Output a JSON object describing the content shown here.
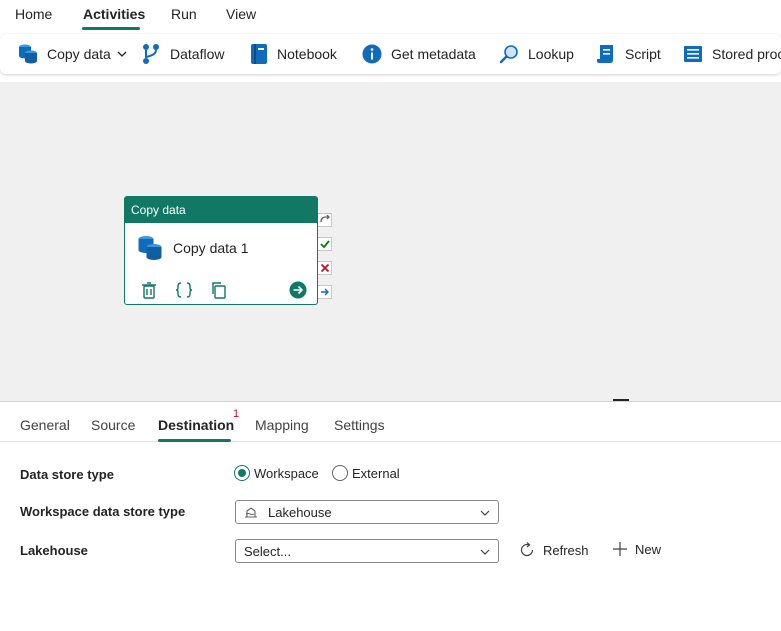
{
  "menu": {
    "items": [
      {
        "label": "Home",
        "active": false
      },
      {
        "label": "Activities",
        "active": true
      },
      {
        "label": "Run",
        "active": false
      },
      {
        "label": "View",
        "active": false
      }
    ]
  },
  "toolbar": {
    "items": [
      {
        "label": "Copy data",
        "icon": "copy-data-icon",
        "has_dropdown": true
      },
      {
        "label": "Dataflow",
        "icon": "dataflow-icon"
      },
      {
        "label": "Notebook",
        "icon": "notebook-icon"
      },
      {
        "label": "Get metadata",
        "icon": "info-icon"
      },
      {
        "label": "Lookup",
        "icon": "search-icon"
      },
      {
        "label": "Script",
        "icon": "script-icon"
      },
      {
        "label": "Stored procedure",
        "icon": "stored-procedure-icon"
      }
    ]
  },
  "activity": {
    "header": "Copy data",
    "name": "Copy data 1",
    "actions": [
      "delete-icon",
      "code-icon",
      "copy-icon",
      "arrow-right-icon"
    ]
  },
  "tabs": {
    "items": [
      {
        "label": "General",
        "active": false
      },
      {
        "label": "Source",
        "active": false
      },
      {
        "label": "Destination",
        "active": true,
        "badge": "1"
      },
      {
        "label": "Mapping",
        "active": false
      },
      {
        "label": "Settings",
        "active": false
      }
    ]
  },
  "destination": {
    "data_store_type": {
      "label": "Data store type",
      "options": [
        "Workspace",
        "External"
      ],
      "selected": "Workspace"
    },
    "workspace_type": {
      "label": "Workspace data store type",
      "value": "Lakehouse"
    },
    "lakehouse": {
      "label": "Lakehouse",
      "placeholder": "Select...",
      "refresh_label": "Refresh",
      "new_label": "New"
    }
  },
  "colors": {
    "accent": "#117865",
    "canvas": "#f0f0f0",
    "badge": "#c50f1f"
  }
}
